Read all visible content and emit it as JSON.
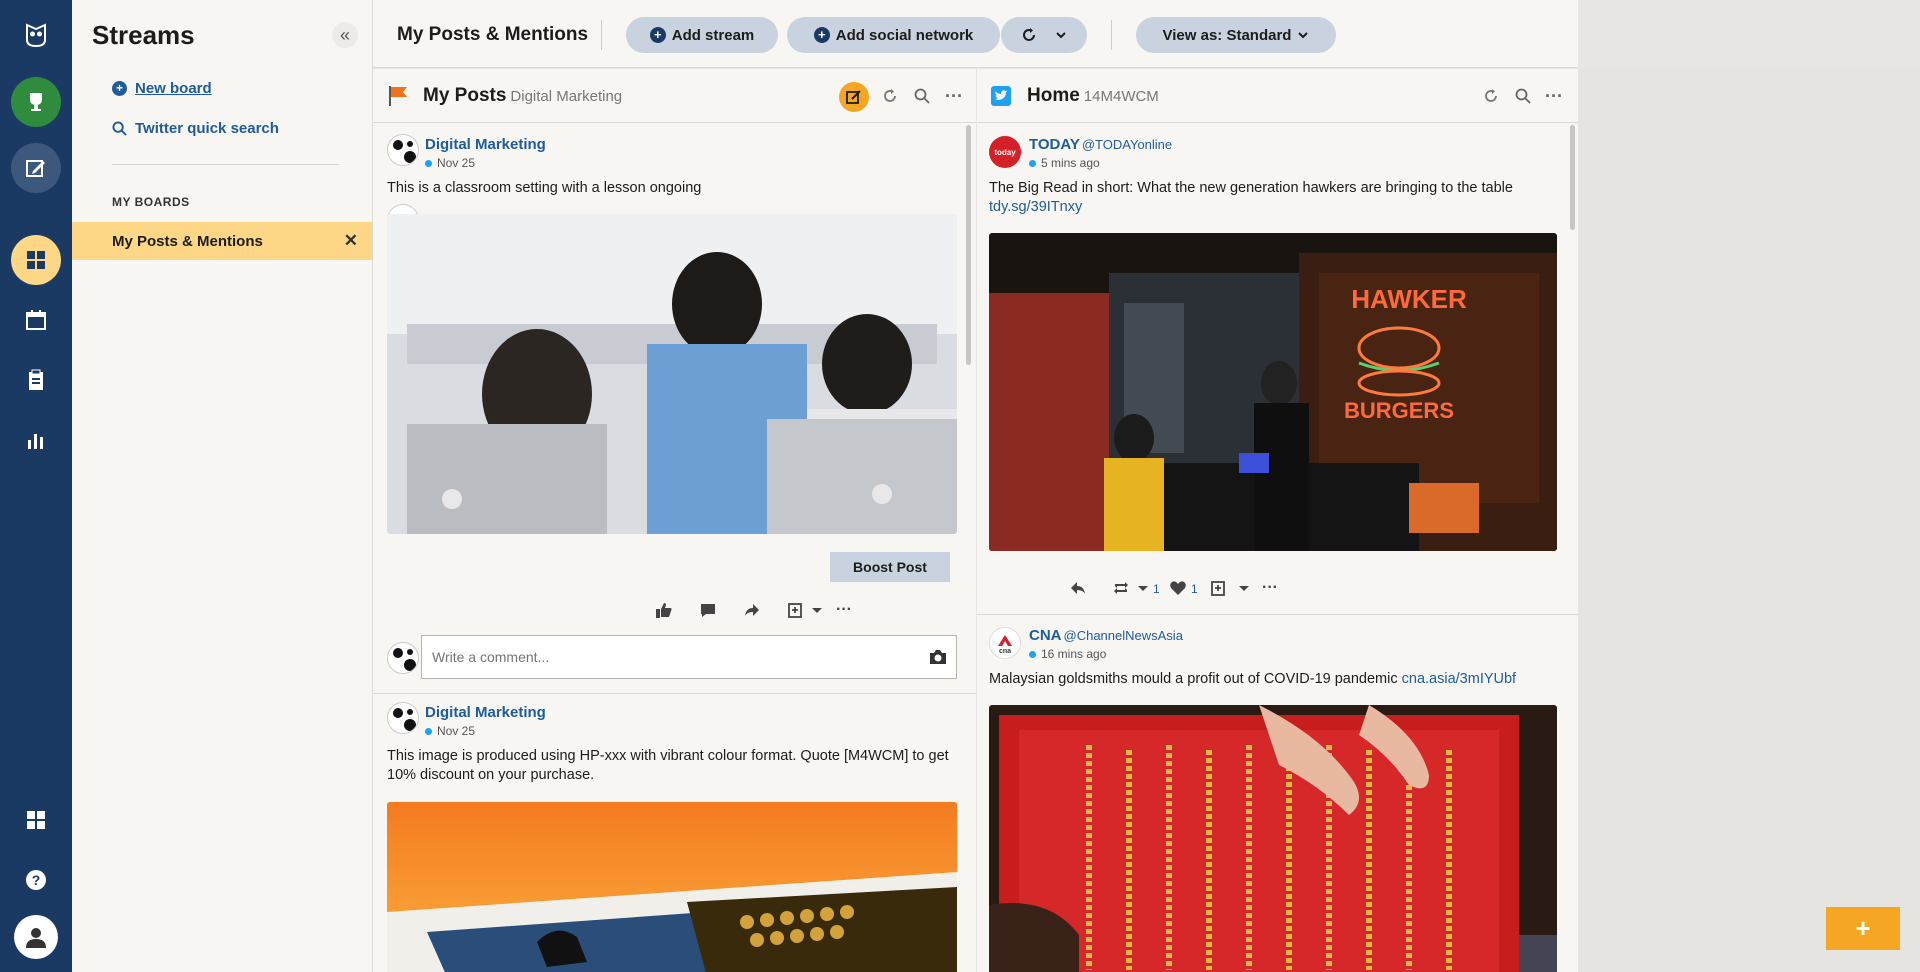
{
  "sidebar": {
    "icons": [
      "owl-logo-icon",
      "trophy-icon",
      "compose-icon",
      "dashboard-icon",
      "calendar-icon",
      "clipboard-icon",
      "analytics-icon",
      "apps-icon",
      "help-icon",
      "profile-icon"
    ]
  },
  "streams_panel": {
    "title": "Streams",
    "collapse_label": "«",
    "new_board": "New board",
    "twitter_search": "Twitter quick search",
    "my_boards_heading": "MY BOARDS",
    "active_board": "My Posts & Mentions"
  },
  "topbar": {
    "board_title": "My Posts & Mentions",
    "add_stream": "Add stream",
    "add_social_network": "Add social network",
    "view_as": "View as: Standard"
  },
  "columns": [
    {
      "title": "My Posts",
      "subtitle": "Digital Marketing",
      "posts": [
        {
          "author": "Digital Marketing",
          "time": "Nov 25",
          "text": "This is a classroom setting with a lesson ongoing",
          "boost_label": "Boost Post",
          "comment_placeholder": "Write a comment..."
        },
        {
          "author": "Digital Marketing",
          "time": "Nov 25",
          "text": "This image is produced using HP-xxx with vibrant colour format. Quote [M4WCM] to get 10% discount on your purchase."
        }
      ]
    },
    {
      "title": "Home",
      "subtitle": "14M4WCM",
      "posts": [
        {
          "author": "TODAY",
          "handle": "@TODAYonline",
          "time": "5 mins ago",
          "text": "The Big Read in short: What the new generation hawkers are bringing to the table",
          "link": "tdy.sg/39ITnxy",
          "retweets": "1",
          "likes": "1"
        },
        {
          "author": "CNA",
          "handle": "@ChannelNewsAsia",
          "time": "16 mins ago",
          "text": "Malaysian goldsmiths mould a profit out of COVID-19 pandemic",
          "link": "cna.asia/3mIYUbf"
        }
      ]
    }
  ],
  "fab_label": "+",
  "colors": {
    "rail": "#1b3a63",
    "accent": "#f5a623",
    "active_board": "#fdd786",
    "link": "#1f5c99"
  }
}
